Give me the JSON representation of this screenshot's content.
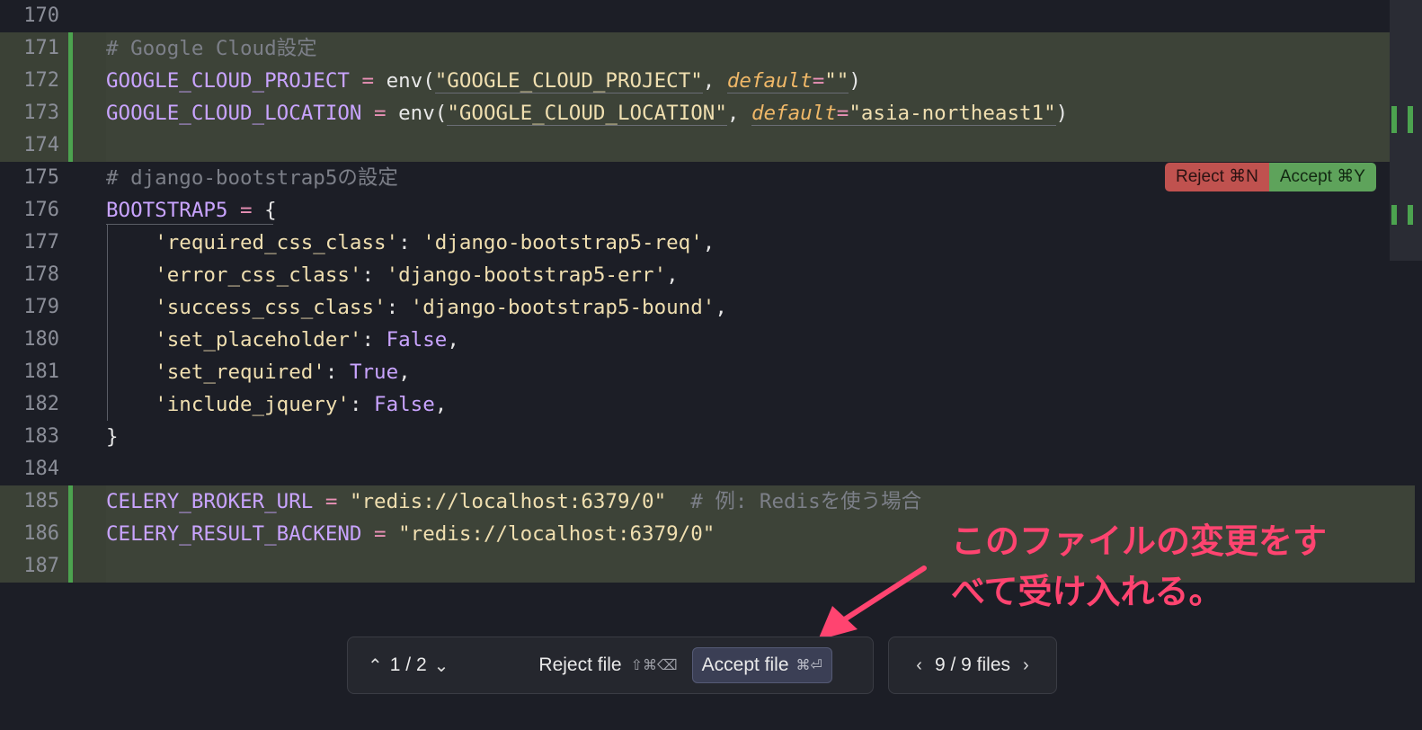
{
  "editor": {
    "lines": [
      {
        "num": "170",
        "added": false,
        "tokens": []
      },
      {
        "num": "171",
        "added": true,
        "tokens": [
          {
            "t": "# Google Cloud設定",
            "c": "comment"
          }
        ]
      },
      {
        "num": "172",
        "added": true,
        "tokens": [
          {
            "t": "GOOGLE_CLOUD_PROJECT",
            "c": "var"
          },
          {
            "t": " = ",
            "c": "op"
          },
          {
            "t": "env(",
            "c": "fn"
          },
          {
            "t": "\"GOOGLE_CLOUD_PROJECT\"",
            "c": "str",
            "u": true
          },
          {
            "t": ", ",
            "c": "punct"
          },
          {
            "t": "default",
            "c": "kw",
            "u": true
          },
          {
            "t": "=",
            "c": "op",
            "u": true
          },
          {
            "t": "\"\"",
            "c": "str",
            "u": true
          },
          {
            "t": ")",
            "c": "punct"
          }
        ]
      },
      {
        "num": "173",
        "added": true,
        "tokens": [
          {
            "t": "GOOGLE_CLOUD_LOCATION",
            "c": "var"
          },
          {
            "t": " = ",
            "c": "op"
          },
          {
            "t": "env(",
            "c": "fn"
          },
          {
            "t": "\"GOOGLE_CLOUD_LOCATION\"",
            "c": "str",
            "u": true
          },
          {
            "t": ", ",
            "c": "punct"
          },
          {
            "t": "default",
            "c": "kw",
            "u": true
          },
          {
            "t": "=",
            "c": "op",
            "u": true
          },
          {
            "t": "\"asia-northeast1\"",
            "c": "str",
            "u": true
          },
          {
            "t": ")",
            "c": "punct"
          }
        ]
      },
      {
        "num": "174",
        "added": true,
        "tokens": []
      },
      {
        "num": "175",
        "added": false,
        "tokens": [
          {
            "t": "# django-bootstrap5の設定",
            "c": "comment"
          }
        ]
      },
      {
        "num": "176",
        "added": false,
        "tokens": [
          {
            "t": "BOOTSTRAP5",
            "c": "var"
          },
          {
            "t": " = ",
            "c": "op"
          },
          {
            "t": "{",
            "c": "punct"
          }
        ]
      },
      {
        "num": "177",
        "added": false,
        "tokens": [
          {
            "t": "    'required_css_class'",
            "c": "str"
          },
          {
            "t": ": ",
            "c": "punct"
          },
          {
            "t": "'django-bootstrap5-req'",
            "c": "str"
          },
          {
            "t": ",",
            "c": "punct"
          }
        ]
      },
      {
        "num": "178",
        "added": false,
        "tokens": [
          {
            "t": "    'error_css_class'",
            "c": "str"
          },
          {
            "t": ": ",
            "c": "punct"
          },
          {
            "t": "'django-bootstrap5-err'",
            "c": "str"
          },
          {
            "t": ",",
            "c": "punct"
          }
        ]
      },
      {
        "num": "179",
        "added": false,
        "tokens": [
          {
            "t": "    'success_css_class'",
            "c": "str"
          },
          {
            "t": ": ",
            "c": "punct"
          },
          {
            "t": "'django-bootstrap5-bound'",
            "c": "str"
          },
          {
            "t": ",",
            "c": "punct"
          }
        ]
      },
      {
        "num": "180",
        "added": false,
        "tokens": [
          {
            "t": "    'set_placeholder'",
            "c": "str"
          },
          {
            "t": ": ",
            "c": "punct"
          },
          {
            "t": "False",
            "c": "bool"
          },
          {
            "t": ",",
            "c": "punct"
          }
        ]
      },
      {
        "num": "181",
        "added": false,
        "tokens": [
          {
            "t": "    'set_required'",
            "c": "str"
          },
          {
            "t": ": ",
            "c": "punct"
          },
          {
            "t": "True",
            "c": "bool"
          },
          {
            "t": ",",
            "c": "punct"
          }
        ]
      },
      {
        "num": "182",
        "added": false,
        "tokens": [
          {
            "t": "    'include_jquery'",
            "c": "str"
          },
          {
            "t": ": ",
            "c": "punct"
          },
          {
            "t": "False",
            "c": "bool"
          },
          {
            "t": ",",
            "c": "punct"
          }
        ]
      },
      {
        "num": "183",
        "added": false,
        "tokens": [
          {
            "t": "}",
            "c": "punct"
          }
        ]
      },
      {
        "num": "184",
        "added": false,
        "tokens": []
      },
      {
        "num": "185",
        "added": true,
        "tokens": [
          {
            "t": "CELERY_BROKER_URL",
            "c": "var"
          },
          {
            "t": " = ",
            "c": "op"
          },
          {
            "t": "\"redis://localhost:6379/0\"",
            "c": "str"
          },
          {
            "t": "  # 例: Redisを使う場合",
            "c": "comment"
          }
        ]
      },
      {
        "num": "186",
        "added": true,
        "tokens": [
          {
            "t": "CELERY_RESULT_BACKEND",
            "c": "var"
          },
          {
            "t": " = ",
            "c": "op"
          },
          {
            "t": "\"redis://localhost:6379/0\"",
            "c": "str"
          }
        ]
      },
      {
        "num": "187",
        "added": true,
        "tokens": []
      }
    ]
  },
  "chunk_actions": {
    "reject_label": "Reject ⌘N",
    "accept_label": "Accept ⌘Y"
  },
  "annotation": {
    "line1": "このファイルの変更をす",
    "line2": "べて受け入れる。",
    "color": "#ff4470"
  },
  "toolbar": {
    "change_counter": "1 / 2",
    "reject_file_label": "Reject file",
    "reject_file_shortcut": "⇧⌘⌫",
    "accept_file_label": "Accept file",
    "accept_file_shortcut": "⌘⏎",
    "files_counter": "9 / 9 files"
  },
  "icons": {
    "prev_change": "chevron-up-icon",
    "next_change": "chevron-down-icon",
    "prev_file": "chevron-left-icon",
    "next_file": "chevron-right-icon"
  },
  "colors": {
    "background": "#1c1e26",
    "added_line": "#3d4338",
    "gutter_added": "#4ca34f",
    "reject": "#c0524f",
    "accept": "#5ea35b"
  }
}
